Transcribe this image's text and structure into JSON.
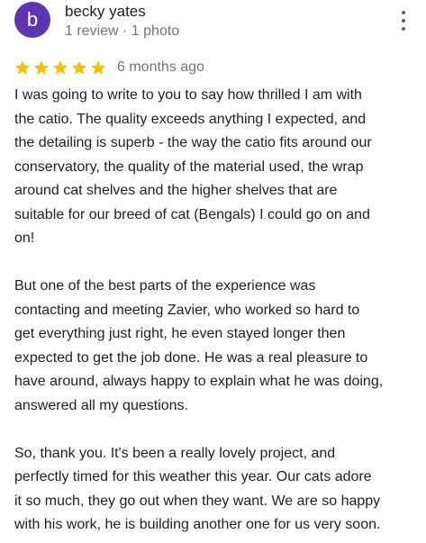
{
  "reviewer": {
    "initial": "b",
    "name": "becky yates",
    "meta": "1 review · 1 photo",
    "avatar_color": "#5e35b1"
  },
  "menu": {
    "icon": "more-vertical-icon"
  },
  "rating": {
    "stars": 5,
    "max_stars": 5,
    "star_color": "#fbbc04",
    "date": "6 months ago"
  },
  "review": {
    "paragraphs": [
      "I was going to write to you to say how thrilled I am with\nthe catio.  The quality exceeds anything I expected, and\nthe detailing is superb - the way the catio fits around our\nconservatory, the quality of the material used, the wrap\naround cat shelves and the higher shelves that are\nsuitable for our breed of cat (Bengals) I could go on and\non!",
      "But one of the best parts of the experience was\ncontacting and meeting Zavier, who worked so hard to\nget everything just right, he even stayed longer then\nexpected to get the job done. He was a real pleasure to\nhave around, always happy to explain what he was doing,\nanswered all my questions.",
      "So, thank you. It's been a really lovely project, and\nperfectly timed for this weather this year. Our cats adore\nit so much, they go out when they want.  We are so happy\nwith his work, he is building another one for us very soon."
    ]
  }
}
